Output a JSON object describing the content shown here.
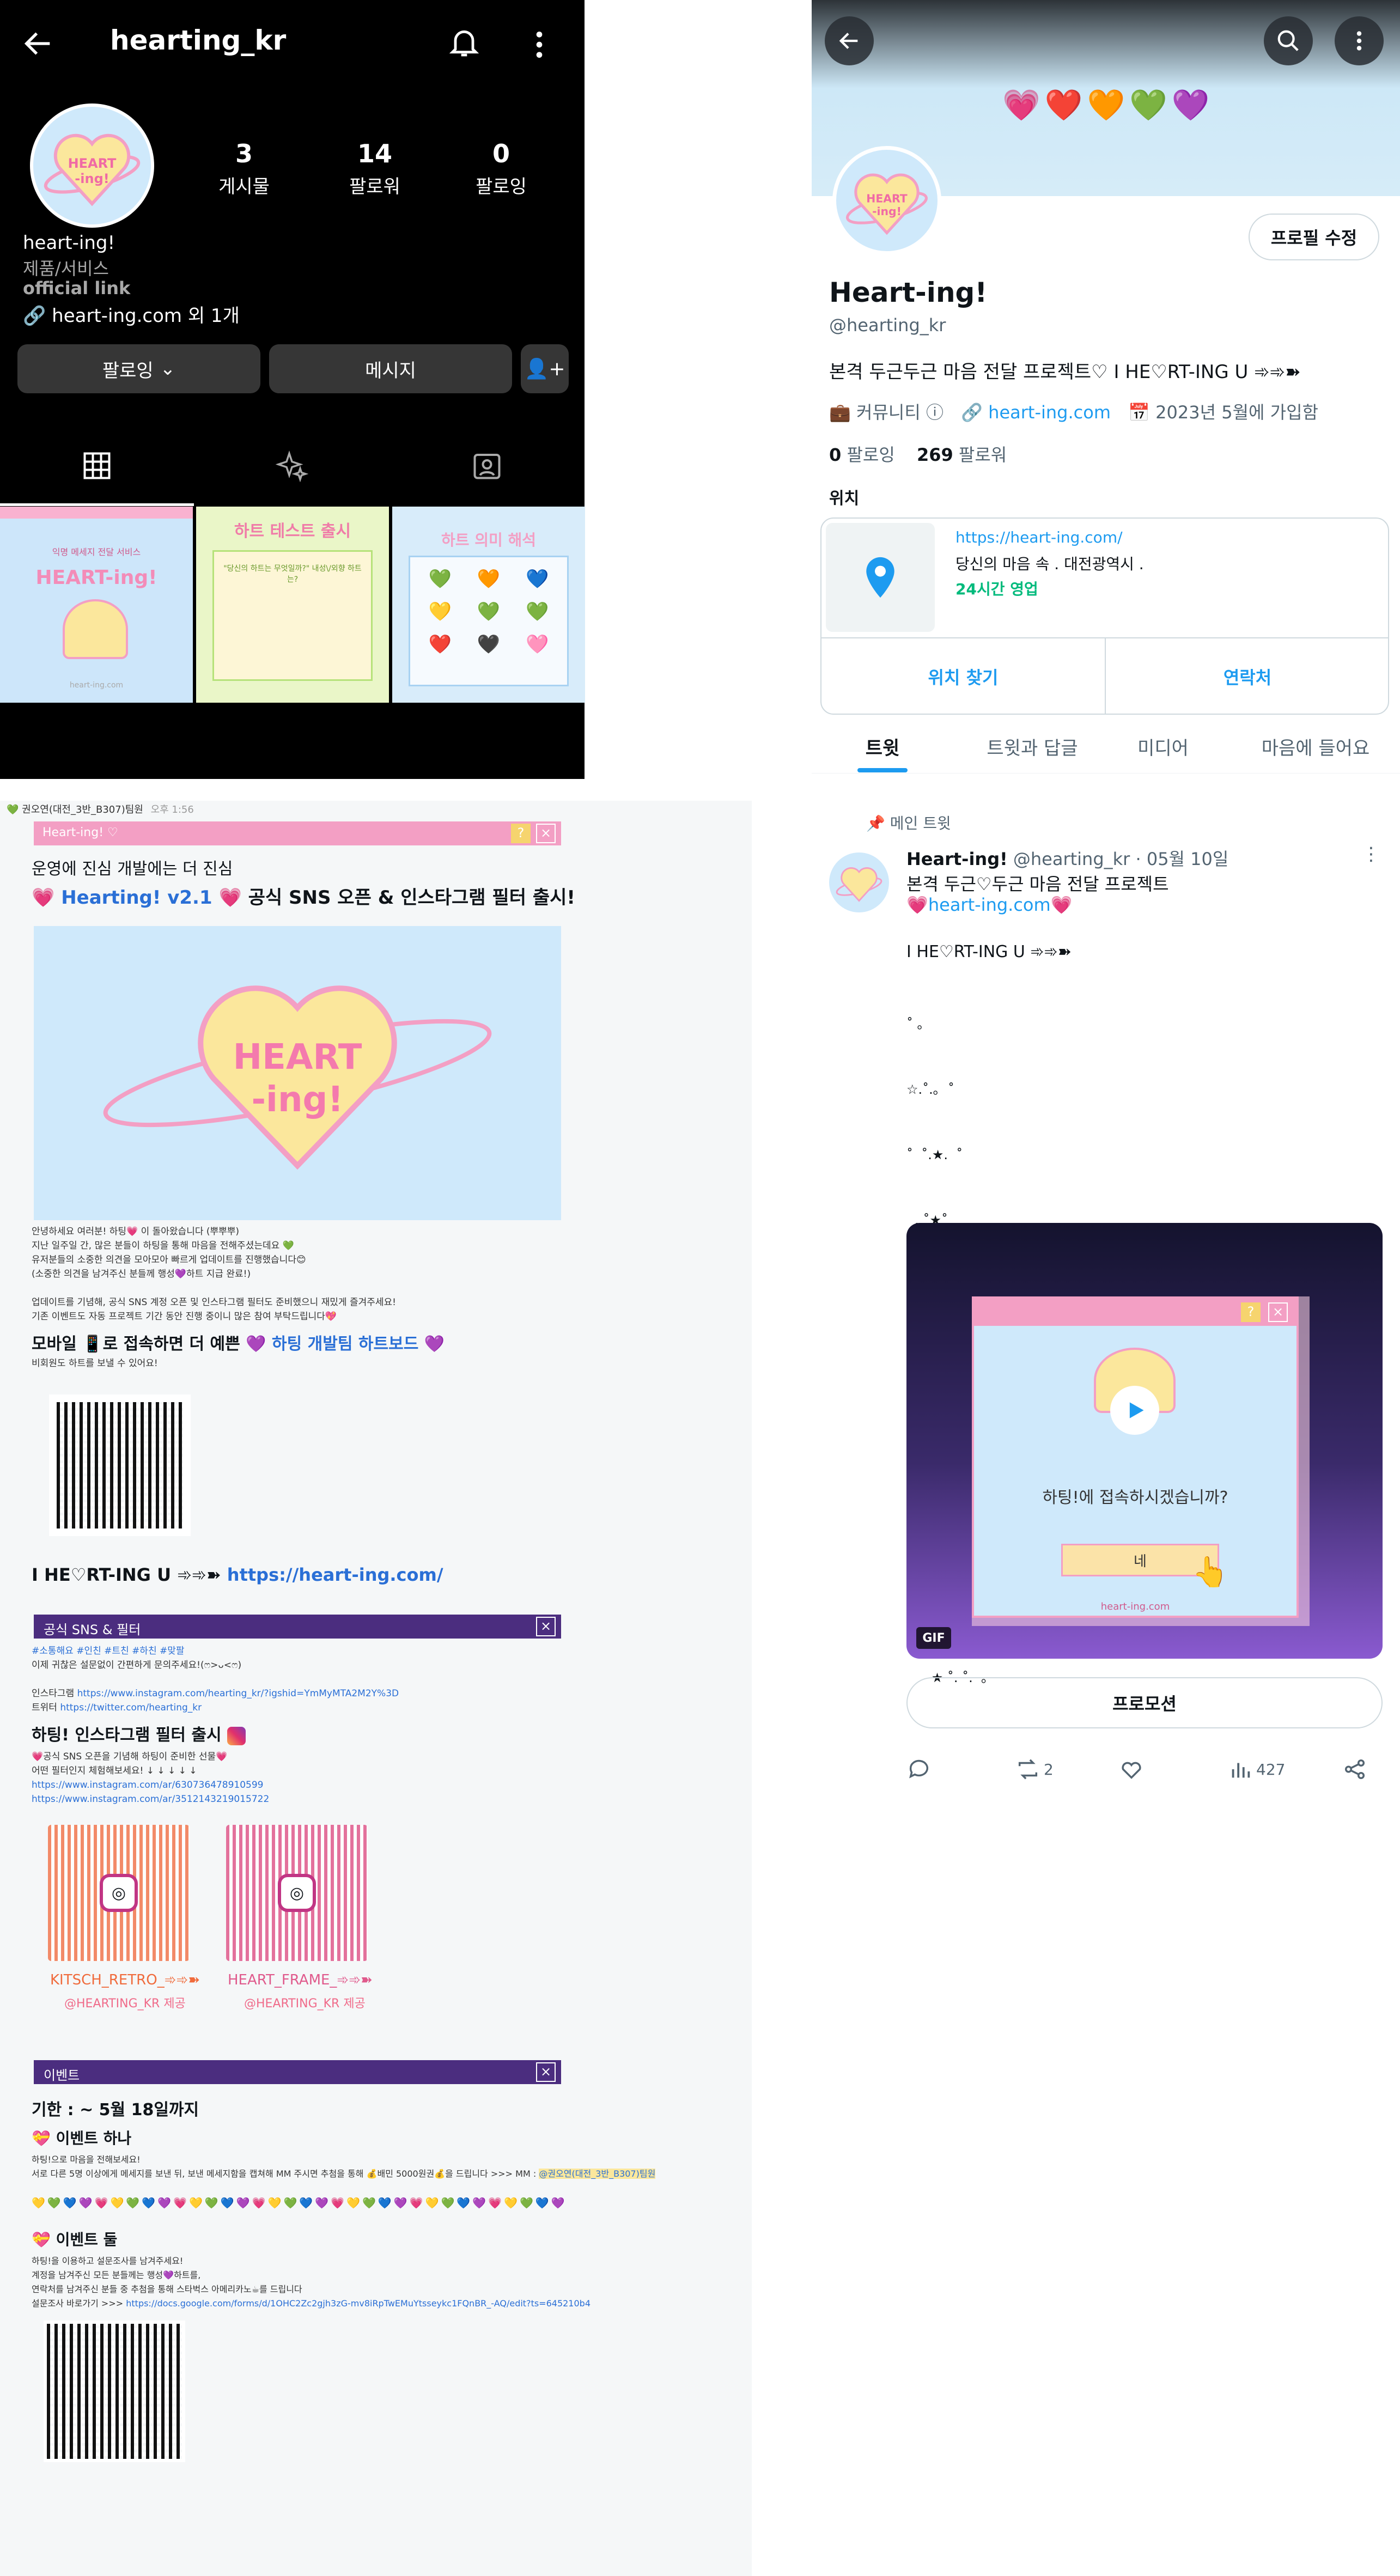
{
  "instagram": {
    "username": "hearting_kr",
    "stats": [
      {
        "count": "3",
        "label": "게시물"
      },
      {
        "count": "14",
        "label": "팔로워"
      },
      {
        "count": "0",
        "label": "팔로잉"
      }
    ],
    "name": "heart-ing!",
    "category": "제품/서비스",
    "official_link": "official link",
    "link": "heart-ing.com 외 1개",
    "following_btn": "팔로잉",
    "message_btn": "메시지",
    "thumbs": [
      {
        "t1": "익명 메세지 전달 서비스",
        "t2": "HEART-ing!",
        "t3": "heart-ing.com"
      },
      {
        "t1": "하트 테스트 출시",
        "t2": "\"당신의 하트는 무엇일까?\" 내성\\/외향 하트는?"
      },
      {
        "t1": "하트 의미 해석",
        "t2": "하트"
      }
    ]
  },
  "twitter": {
    "edit_profile": "프로필 수정",
    "display_name": "Heart-ing!",
    "handle": "@hearting_kr",
    "bio": "본격 두근두근 마음 전달 프로젝트♡ I HE♡RT-ING U ➾➾➽",
    "community": "커뮤니티",
    "website": "heart-ing.com",
    "joined": "2023년 5월에 가입함",
    "following_count": "0",
    "following_label": "팔로잉",
    "followers_count": "269",
    "followers_label": "팔로워",
    "location_label": "위치",
    "location_url": "https://heart-ing.com/",
    "location_addr": "당신의 마음 속 . 대전광역시 .",
    "location_hours": "24시간 영업",
    "find_location": "위치 찾기",
    "contact": "연락처",
    "tabs": [
      "트윗",
      "트윗과 답글",
      "미디어",
      "마음에 들어요"
    ]
  },
  "tweet": {
    "pinned": "메인 트윗",
    "name": "Heart-ing!",
    "handle": "@hearting_kr",
    "date": "· 05월 10일",
    "line1": "본격 두근♡두근 마음 전달 프로젝트",
    "line2": "💗heart-ing.com💗",
    "line3": "I HE♡RT-ING U ➾➾➽",
    "stars": [
      "˚ ｡",
      "☆.˚.｡  ˚",
      "˚  ˚.★.  ˚",
      "  . ˚★˚",
      "  ˚  ☆.  ˚",
      "˚ . ˚. ★.",
      "   ☆  ˚.  ˚",
      "   ˚. ˚.˚.˚",
      "˚     ˚.☆. ★   .",
      "   ˚.☆ .˚. ˚",
      "      ★ ˚. ˚.  ｡"
    ],
    "media_question": "하팅!에 접속하시겠습니까?",
    "media_yes": "네",
    "media_url": "heart-ing.com",
    "gif_badge": "GIF",
    "promotion": "프로모션",
    "retweets": "2",
    "views": "427"
  },
  "doc": {
    "author": "권오연(대전_3반_B307)팀원",
    "time": "오후 1:56",
    "window_title": "Heart-ing! ♡",
    "headline1": "운영에 진심 개발에는 더 진심",
    "headline2_pre": "Hearting! v2.1",
    "headline2_post": "공식 SNS 오픈 & 인스타그램 필터 출시!",
    "body_lines": [
      "안녕하세요 여러분! 하팅💗 이 돌아왔습니다 (뿌뿌뿌)",
      "지난 일주일 간, 많은 분들이 하팅을 통해 마음을 전해주셨는데요 💚",
      "유저분들의 소중한 의견을 모아모아 빠르게 업데이트를 진행했습니다😊",
      "(소중한 의견을 남겨주신 분들께 행성💜하트 지급 완료!)",
      "",
      "업데이트를 기념해, 공식 SNS 계정 오픈 및 인스타그램 필터도 준비했으니 재밌게 즐겨주세요!",
      "기존 이벤트도 자동 프로젝트 기간 동안 진행 중이니 많은 참여 부탁드립니다💖"
    ],
    "mobile_line_pre": "모바일 📱로 접속하면 더 예쁜",
    "mobile_line_post": "하팅 개발팀 하트보드",
    "mobile_sub": "비회원도 하트를 보낼 수 있어요!",
    "url_pre": "I HE♡RT-ING U ➾➾➽",
    "url": "https://heart-ing.com/",
    "sns_title": "공식 SNS & 필터",
    "sns_tags": "#소통해요 #인친 #트친 #하친 #맞팔",
    "sns_desc": "이제 귀찮은 설문없이 간편하게 문의주세요!(ෆ>ᴗ<ෆ)",
    "instagram_label": "인스타그램",
    "instagram_url": "https://www.instagram.com/hearting_kr/?igshid=YmMyMTA2M2Y%3D",
    "twitter_label": "트위터",
    "twitter_url": "https://twitter.com/hearting_kr",
    "filter_title": "하팅! 인스타그램 필터 출시",
    "filter_desc1": "💗공식 SNS 오픈을 기념해 하팅이 준비한 선물💗",
    "filter_desc2": "어떤 필터인지 체험해보세요! ↓ ↓ ↓ ↓ ↓",
    "filter_url1": "https://www.instagram.com/ar/630736478910599",
    "filter_url2": "https://www.instagram.com/ar/3512143219015722",
    "filters": [
      {
        "name": "KITSCH_RETRO_➾➾➽",
        "by": "@HEARTING_KR 제공"
      },
      {
        "name": "HEART_FRAME_➾➾➽",
        "by": "@HEARTING_KR 제공"
      }
    ],
    "event_title": "이벤트",
    "deadline": "기한 : ~ 5월 18일까지",
    "event1": "이벤트 하나",
    "event1_desc1": "하팅!으로 마음을 전해보세요!",
    "event1_desc2": "서로 다른 5명 이상에게 메세지를 보낸 뒤, 보낸 메세지함을 캡쳐해 MM 주시면 추첨을 통해 💰배민 5000원권💰을 드립니다 >>> MM :",
    "event1_mm": "@권오연(대전_3반_B307)팀원",
    "event2": "이벤트 둘",
    "event2_desc1": "하팅!을 이용하고 설문조사를 남겨주세요!",
    "event2_desc2": "계정을 남겨주신 모든 분들께는 행성💜하트를,",
    "event2_desc3": "연락처를 남겨주신 분들 중 추첨을 통해 스타벅스 아메리카노☕를 드립니다",
    "event2_desc4": "설문조사 바로가기 >>>",
    "survey_url": "https://docs.google.com/forms/d/1OHC2Zc2gjh3zG-mv8iRpTwEMuYtsseykc1FQnBR_-AQ/edit?ts=645210b4"
  },
  "colors": {
    "accent_blue": "#1d9bf0",
    "pink": "#f39fc4",
    "purple": "#4b2d7f",
    "link_blue": "#2a6fd6"
  }
}
